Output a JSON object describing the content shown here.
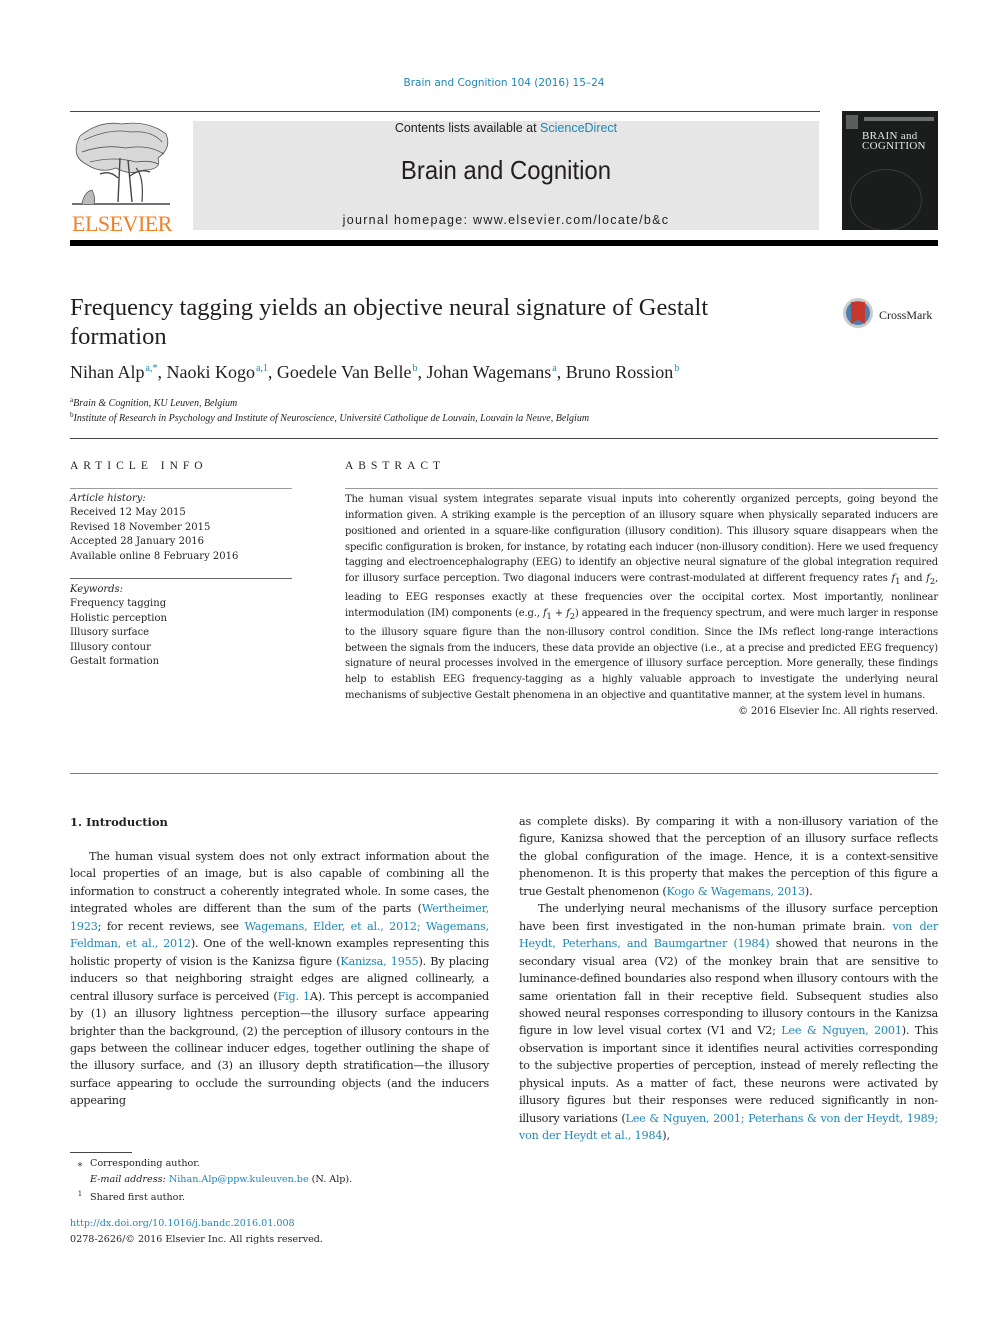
{
  "header": {
    "journal_ref": "Brain and Cognition 104 (2016) 15–24",
    "contents_prefix": "Contents lists available at ",
    "contents_link": "ScienceDirect",
    "journal_name": "Brain and Cognition",
    "homepage": "journal homepage: www.elsevier.com/locate/b&c",
    "publisher_logo_text": "ELSEVIER",
    "cover_title_line1": "BRAIN and",
    "cover_title_line2": "COGNITION",
    "crossmark_label": "CrossMark"
  },
  "article": {
    "title": "Frequency tagging yields an objective neural signature of Gestalt formation",
    "authors": [
      {
        "name": "Nihan Alp",
        "sup": "a,*"
      },
      {
        "name": "Naoki Kogo",
        "sup": "a,1"
      },
      {
        "name": "Goedele Van Belle",
        "sup": "b"
      },
      {
        "name": "Johan Wagemans",
        "sup": "a"
      },
      {
        "name": "Bruno Rossion",
        "sup": "b"
      }
    ],
    "affiliations": [
      {
        "mark": "a",
        "text": "Brain & Cognition, KU Leuven, Belgium"
      },
      {
        "mark": "b",
        "text": "Institute of Research in Psychology and Institute of Neuroscience, Université Catholique de Louvain, Louvain la Neuve, Belgium"
      }
    ]
  },
  "article_info": {
    "heading": "ARTICLE INFO",
    "history_label": "Article history:",
    "history": [
      "Received 12 May 2015",
      "Revised 18 November 2015",
      "Accepted 28 January 2016",
      "Available online 8 February 2016"
    ],
    "keywords_label": "Keywords:",
    "keywords": [
      "Frequency tagging",
      "Holistic perception",
      "Illusory surface",
      "Illusory contour",
      "Gestalt formation"
    ]
  },
  "abstract": {
    "heading": "ABSTRACT",
    "text_1": "The human visual system integrates separate visual inputs into coherently organized percepts, going beyond the information given. A striking example is the perception of an illusory square when physically separated inducers are positioned and oriented in a square-like configuration (illusory condition). This illusory square disappears when the specific configuration is broken, for instance, by rotating each inducer (non-illusory condition). Here we used frequency tagging and electroencephalography (EEG) to identify an objective neural signature of the global integration required for illusory surface perception. Two diagonal inducers were contrast-modulated at different frequency rates ",
    "f1": "f",
    "f1_sub": "1",
    "and": " and ",
    "f2": "f",
    "f2_sub": "2",
    "text_2": ", leading to EEG responses exactly at these frequencies over the occipital cortex. Most importantly, nonlinear intermodulation (IM) components (e.g., ",
    "sum_expr_plus": " + ",
    "text_3": ") appeared in the frequency spectrum, and were much larger in response to the illusory square figure than the non-illusory control condition. Since the IMs reflect long-range interactions between the signals from the inducers, these data provide an objective (i.e., at a precise and predicted EEG frequency) signature of neural processes involved in the emergence of illusory surface perception. More generally, these findings help to establish EEG frequency-tagging as a highly valuable approach to investigate the underlying neural mechanisms of subjective Gestalt phenomena in an objective and quantitative manner, at the system level in humans.",
    "copyright": "© 2016 Elsevier Inc. All rights reserved."
  },
  "introduction": {
    "heading": "1. Introduction",
    "p1_a": "The human visual system does not only extract information about the local properties of an image, but is also capable of combining all the information to construct a coherently integrated whole. In some cases, the integrated wholes are different than the sum of the parts (",
    "p1_ref1": "Wertheimer, 1923",
    "p1_b": "; for recent reviews, see ",
    "p1_ref2": "Wagemans, Elder, et al., 2012; Wagemans, Feldman, et al., 2012",
    "p1_c": "). One of the well-known examples representing this holistic property of vision is the Kanizsa figure (",
    "p1_ref3": "Kanizsa, 1955",
    "p1_d": "). By placing inducers so that neighboring straight edges are aligned collinearly, a central illusory surface is perceived (",
    "p1_ref4": "Fig. 1",
    "p1_e": "A). This percept is accompanied by (1) an illusory lightness perception—the illusory surface appearing brighter than the background, (2) the perception of illusory contours in the gaps between the collinear inducer edges, together outlining the shape of the illusory surface, and (3) an illusory depth stratification—the illusory surface appearing to occlude the surrounding objects (and the inducers appearing",
    "p1_f": "as complete disks). By comparing it with a non-illusory variation of the figure, Kanizsa showed that the perception of an illusory surface reflects the global configuration of the image. Hence, it is a context-sensitive phenomenon. It is this property that makes the perception of this figure a true Gestalt phenomenon (",
    "p1_ref5": "Kogo & Wagemans, 2013",
    "p1_g": ").",
    "p2_a": "The underlying neural mechanisms of the illusory surface perception have been first investigated in the non-human primate brain. ",
    "p2_ref1": "von der Heydt, Peterhans, and Baumgartner (1984)",
    "p2_b": " showed that neurons in the secondary visual area (V2) of the monkey brain that are sensitive to luminance-defined boundaries also respond when illusory contours with the same orientation fall in their receptive field. Subsequent studies also showed neural responses corresponding to illusory contours in the Kanizsa figure in low level visual cortex (V1 and V2; ",
    "p2_ref2": "Lee & Nguyen, 2001",
    "p2_c": "). This observation is important since it identifies neural activities corresponding to the subjective properties of perception, instead of merely reflecting the physical inputs. As a matter of fact, these neurons were activated by illusory figures but their responses were reduced significantly in non-illusory variations (",
    "p2_ref3": "Lee & Nguyen, 2001; Peterhans & von der Heydt, 1989; von der Heydt et al., 1984",
    "p2_d": "),"
  },
  "footnotes": {
    "corresponding_mark": "⁎",
    "corresponding": "Corresponding author.",
    "email_label": "E-mail address: ",
    "email": "Nihan.Alp@ppw.kuleuven.be",
    "email_suffix": " (N. Alp).",
    "shared_mark": "1",
    "shared": "Shared first author.",
    "doi": "http://dx.doi.org/10.1016/j.bandc.2016.01.008",
    "issn": "0278-2626/© 2016 Elsevier Inc. All rights reserved."
  },
  "colors": {
    "link": "#1f87b4",
    "elsevier_orange": "#f47e20",
    "header_box": "#e6e6e6"
  }
}
